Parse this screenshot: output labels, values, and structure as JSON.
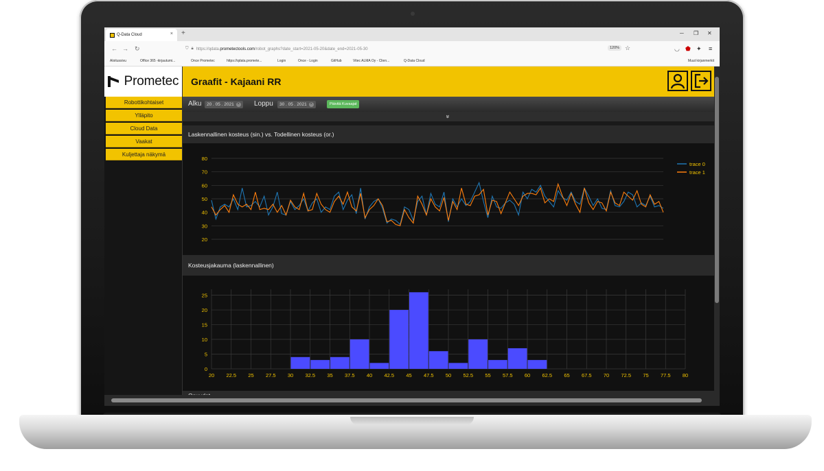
{
  "browser": {
    "tab_title": "Q-Data Cloud",
    "tab_close": "×",
    "new_tab": "+",
    "url_prefix": "https://qdata.",
    "url_domain": "prometectools.com",
    "url_rest": "/robot_graphs?date_start=2021-05-20&date_end=2021-05-30",
    "zoom": "120%",
    "bookmarks": [
      "Aloitussivu",
      "Office 365 -kirjautumi...",
      "Once Prometec",
      "https://qdata.promete...",
      "Login",
      "Once - Login",
      "GitHub",
      "Vitec ALMA Oy - Clien...",
      "Q-Data Cloud"
    ],
    "bookmarks_other": "Muut kirjanmerkit"
  },
  "app": {
    "logo": "Prometec",
    "nav": [
      "Robottikohtaiset",
      "Ylläpito",
      "Cloud Data",
      "Vaakat",
      "Kuljettaja näkymä"
    ],
    "title": "Graafit - Kajaani RR",
    "date_start_label": "Alku",
    "date_start": "20 . 05 . 2021",
    "date_end_label": "Loppu",
    "date_end": "30 . 05 . 2021",
    "refresh_label": "Päivitä Kuvaajat",
    "chevron": "»",
    "panel1_title": "Laskennallinen kosteus (sin.) vs. Todellinen kosteus (or.)",
    "panel2_title": "Kosteusjakauma (laskennallinen)",
    "panel3_title": "Osuudet",
    "colors": {
      "accent": "#f2c300",
      "trace0": "#1f77b4",
      "trace1": "#ff7f0e",
      "bar": "#4b4bff",
      "tick": "#f2c300"
    }
  },
  "chart_data": [
    {
      "type": "line",
      "title": "Laskennallinen kosteus (sin.) vs. Todellinen kosteus (or.)",
      "ylim": [
        20,
        80
      ],
      "yticks": [
        20,
        30,
        40,
        50,
        60,
        70,
        80
      ],
      "legend_position": "top-right",
      "series": [
        {
          "name": "trace 0",
          "values": [
            49,
            35,
            44,
            46,
            44,
            50,
            42,
            58,
            44,
            45,
            48,
            44,
            52,
            38,
            44,
            55,
            39,
            38,
            48,
            42,
            45,
            50,
            41,
            47,
            50,
            40,
            44,
            42,
            52,
            55,
            42,
            49,
            53,
            39,
            58,
            35,
            44,
            48,
            50,
            43,
            32,
            35,
            34,
            31,
            44,
            42,
            34,
            48,
            52,
            38,
            54,
            46,
            44,
            55,
            33,
            50,
            44,
            50,
            45,
            48,
            55,
            62,
            48,
            36,
            52,
            44,
            43,
            47,
            49,
            46,
            38,
            55,
            50,
            57,
            55,
            60,
            52,
            48,
            44,
            56,
            51,
            49,
            55,
            48,
            46,
            58,
            52,
            45,
            50,
            43,
            42,
            56,
            45,
            44,
            48,
            55,
            53,
            44,
            47,
            45,
            52,
            44,
            45,
            43
          ]
        },
        {
          "name": "trace 1",
          "values": [
            44,
            38,
            42,
            45,
            40,
            53,
            46,
            44,
            46,
            42,
            55,
            42,
            43,
            42,
            46,
            40,
            45,
            38,
            49,
            44,
            42,
            54,
            41,
            42,
            54,
            46,
            42,
            40,
            48,
            52,
            46,
            55,
            44,
            41,
            54,
            36,
            42,
            45,
            50,
            45,
            33,
            34,
            31,
            30,
            42,
            36,
            32,
            52,
            46,
            38,
            50,
            44,
            41,
            51,
            34,
            48,
            42,
            58,
            46,
            45,
            52,
            53,
            57,
            38,
            49,
            48,
            39,
            47,
            55,
            50,
            45,
            52,
            54,
            54,
            53,
            58,
            47,
            50,
            48,
            61,
            52,
            45,
            54,
            46,
            40,
            58,
            47,
            42,
            48,
            47,
            41,
            55,
            47,
            45,
            55,
            52,
            49,
            56,
            46,
            44,
            53,
            46,
            48,
            40
          ]
        }
      ]
    },
    {
      "type": "bar",
      "title": "Kosteusjakauma (laskennallinen)",
      "x_ticks": [
        "20",
        "22.5",
        "25",
        "27.5",
        "30",
        "32.5",
        "35",
        "37.5",
        "40",
        "42.5",
        "45",
        "47.5",
        "50",
        "52.5",
        "55",
        "57.5",
        "60",
        "62.5",
        "65",
        "67.5",
        "70",
        "72.5",
        "75",
        "77.5",
        "80"
      ],
      "bin_width": 2.5,
      "bins": [
        {
          "start": 30,
          "value": 4
        },
        {
          "start": 32.5,
          "value": 3
        },
        {
          "start": 35,
          "value": 4
        },
        {
          "start": 37.5,
          "value": 10
        },
        {
          "start": 40,
          "value": 2
        },
        {
          "start": 42.5,
          "value": 20
        },
        {
          "start": 45,
          "value": 26
        },
        {
          "start": 47.5,
          "value": 6
        },
        {
          "start": 50,
          "value": 2
        },
        {
          "start": 52.5,
          "value": 10
        },
        {
          "start": 55,
          "value": 3
        },
        {
          "start": 57.5,
          "value": 7
        },
        {
          "start": 60,
          "value": 3
        }
      ],
      "xlim": [
        20,
        80
      ],
      "ylim": [
        0,
        27
      ],
      "yticks": [
        0,
        5,
        10,
        15,
        20,
        25
      ],
      "grid": true
    }
  ]
}
